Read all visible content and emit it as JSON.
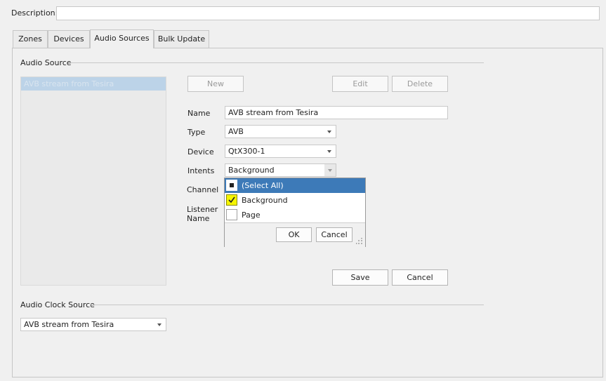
{
  "header": {
    "description_label": "Description:",
    "description_value": ""
  },
  "tabs": [
    {
      "label": "Zones",
      "active": false
    },
    {
      "label": "Devices",
      "active": false
    },
    {
      "label": "Audio Sources",
      "active": true
    },
    {
      "label": "Bulk Update",
      "active": false
    }
  ],
  "audio_source": {
    "group_title": "Audio Source",
    "list_items": [
      {
        "label": "AVB stream from Tesira",
        "selected": true
      }
    ],
    "buttons": {
      "new": "New",
      "edit": "Edit",
      "delete": "Delete",
      "save": "Save",
      "cancel": "Cancel"
    },
    "form": {
      "name_label": "Name",
      "name_value": "AVB stream from Tesira",
      "type_label": "Type",
      "type_value": "AVB",
      "device_label": "Device",
      "device_value": "QtX300-1",
      "intents_label": "Intents",
      "intents_value": "Background",
      "channel_label": "Channel",
      "listener_label_1": "Listener",
      "listener_label_2": "Name"
    },
    "intents_popup": {
      "options": [
        {
          "label": "(Select All)",
          "state": "indeterminate",
          "highlighted": true
        },
        {
          "label": "Background",
          "state": "checked",
          "highlighted": false
        },
        {
          "label": "Page",
          "state": "unchecked",
          "highlighted": false
        }
      ],
      "ok_label": "OK",
      "cancel_label": "Cancel"
    }
  },
  "clock": {
    "group_title": "Audio Clock Source",
    "value": "AVB stream from Tesira"
  },
  "colors": {
    "highlight": "#3d7ab8",
    "checked_fill": "#f5f500",
    "selected_list_item": "#bcd3e8"
  }
}
